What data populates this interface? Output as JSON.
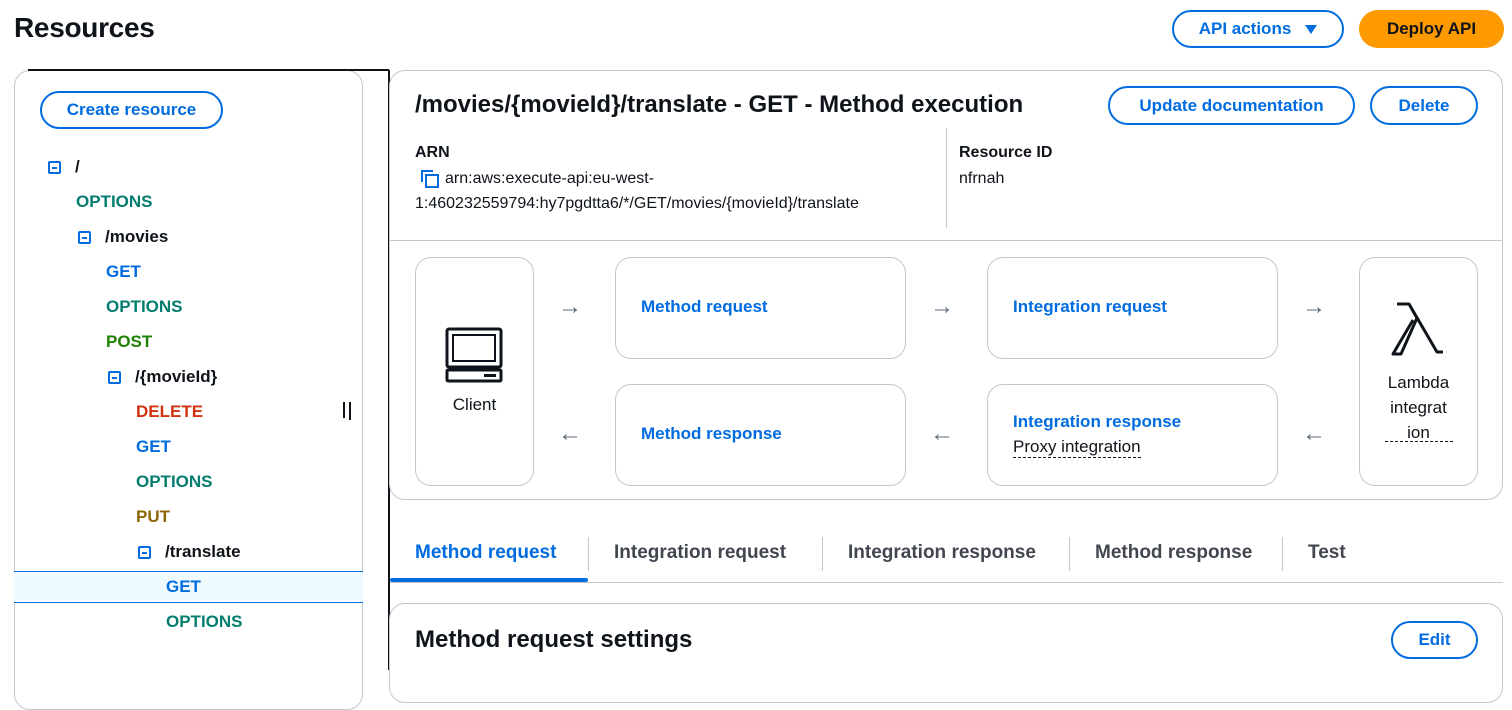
{
  "header": {
    "title": "Resources",
    "api_actions_label": "API actions",
    "deploy_label": "Deploy API"
  },
  "sidebar": {
    "create_resource_label": "Create resource",
    "tree": {
      "root": "/",
      "root_options": "OPTIONS",
      "movies": "/movies",
      "movies_get": "GET",
      "movies_options": "OPTIONS",
      "movies_post": "POST",
      "movieid": "/{movieId}",
      "movieid_delete": "DELETE",
      "movieid_get": "GET",
      "movieid_options": "OPTIONS",
      "movieid_put": "PUT",
      "translate": "/translate",
      "translate_get": "GET",
      "translate_options": "OPTIONS"
    }
  },
  "method": {
    "title": "/movies/{movieId}/translate - GET - Method execution",
    "update_doc_label": "Update documentation",
    "delete_label": "Delete",
    "arn_label": "ARN",
    "arn_line1": "arn:aws:execute-api:eu-west-",
    "arn_line2": "1:460232559794:hy7pgdtta6/*/GET/movies/{movieId}/translate",
    "resource_id_label": "Resource ID",
    "resource_id_value": "nfrnah"
  },
  "flow": {
    "client_label": "Client",
    "method_request": "Method request",
    "integration_request": "Integration request",
    "method_response": "Method response",
    "integration_response": "Integration response",
    "proxy_integration": "Proxy integration",
    "lambda_line1": "Lambda",
    "lambda_line2": "integrat",
    "lambda_line3": "ion",
    "arrow_right": "→",
    "arrow_left": "←"
  },
  "tabs": [
    {
      "label": "Method request",
      "active": true
    },
    {
      "label": "Integration request",
      "active": false
    },
    {
      "label": "Integration response",
      "active": false
    },
    {
      "label": "Method response",
      "active": false
    },
    {
      "label": "Test",
      "active": false
    }
  ],
  "settings": {
    "title": "Method request settings",
    "edit_label": "Edit"
  },
  "colors": {
    "accent": "#006ce0",
    "deploy": "#ff9900",
    "options": "#047d6f",
    "post": "#1d8102",
    "delete": "#d13212",
    "put": "#8d6605"
  },
  "icons": [
    "caret-down-icon",
    "collapse-icon",
    "copy-icon",
    "laptop-icon",
    "lambda-icon"
  ]
}
